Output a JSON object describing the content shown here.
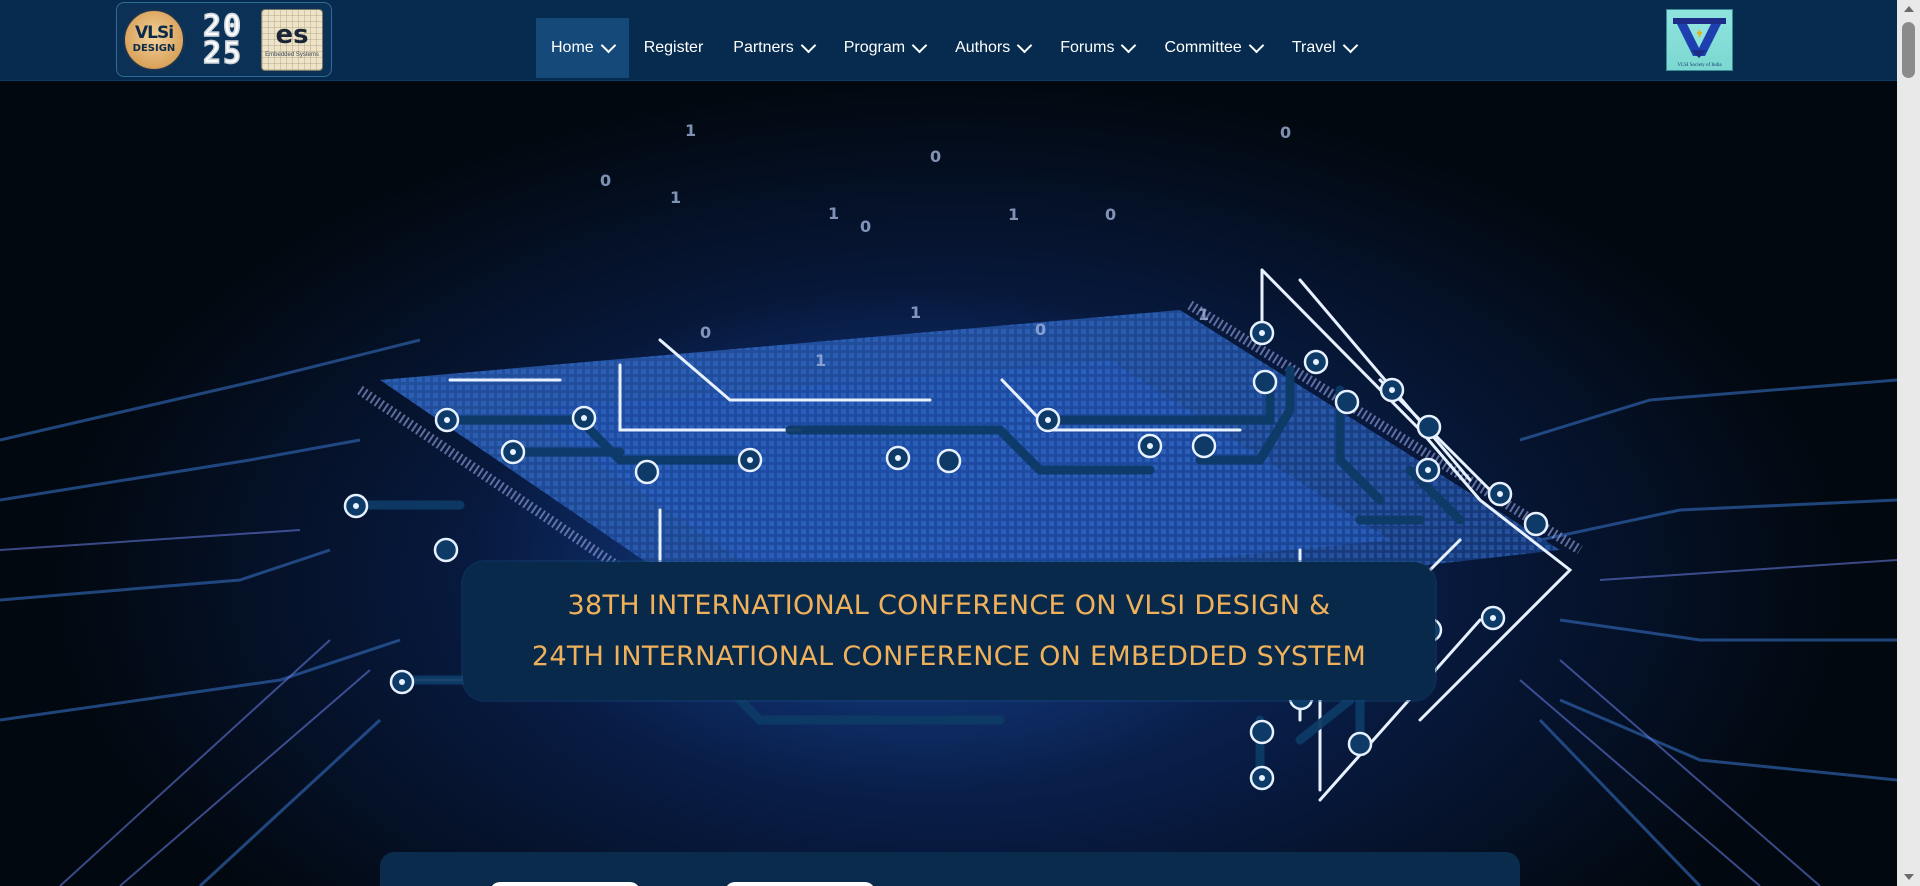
{
  "header": {
    "logo": {
      "vlsi_line1": "VLSi",
      "vlsi_line2": "DESIGN",
      "year_top": "20",
      "year_bottom": "25",
      "es_mark": "es",
      "es_sub": "Embedded Systems"
    },
    "nav": [
      {
        "label": "Home",
        "active": true,
        "dropdown": true
      },
      {
        "label": "Register",
        "active": false,
        "dropdown": false
      },
      {
        "label": "Partners",
        "active": false,
        "dropdown": true
      },
      {
        "label": "Program",
        "active": false,
        "dropdown": true
      },
      {
        "label": "Authors",
        "active": false,
        "dropdown": true
      },
      {
        "label": "Forums",
        "active": false,
        "dropdown": true
      },
      {
        "label": "Committee",
        "active": false,
        "dropdown": true
      },
      {
        "label": "Travel",
        "active": false,
        "dropdown": true
      }
    ],
    "society_logo_caption": "VLSI Society of India"
  },
  "hero": {
    "title_line1": "38TH INTERNATIONAL CONFERENCE ON VLSI DESIGN &",
    "title_line2": "24TH INTERNATIONAL CONFERENCE ON EMBEDDED SYSTEM"
  },
  "colors": {
    "header_bg": "#062b4e",
    "active_nav": "#15497a",
    "banner_bg": "#08294a",
    "title_text": "#f1b15a"
  }
}
